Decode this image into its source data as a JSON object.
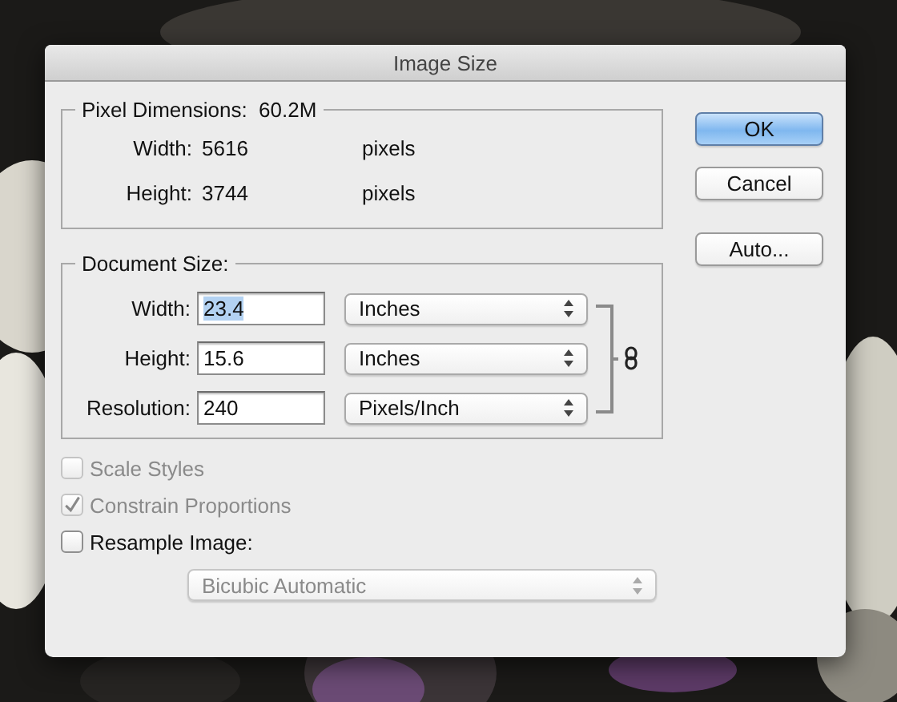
{
  "window": {
    "title": "Image Size"
  },
  "pixel_dimensions": {
    "label": "Pixel Dimensions:",
    "value": "60.2M",
    "rows": [
      {
        "label": "Width:",
        "value": "5616",
        "unit": "pixels"
      },
      {
        "label": "Height:",
        "value": "3744",
        "unit": "pixels"
      }
    ]
  },
  "buttons": [
    {
      "label": "OK",
      "default": true
    },
    {
      "label": "Cancel",
      "default": false
    },
    {
      "label": "Auto...",
      "default": false
    }
  ],
  "document_size": {
    "label": "Document Size:",
    "rows": [
      {
        "label": "Width:",
        "value": "23.4",
        "selected": true,
        "unit": "Inches"
      },
      {
        "label": "Height:",
        "value": "15.6",
        "selected": false,
        "unit": "Inches"
      },
      {
        "label": "Resolution:",
        "value": "240",
        "selected": false,
        "unit": "Pixels/Inch"
      }
    ]
  },
  "options": [
    {
      "label": "Scale Styles",
      "checked": false,
      "disabled": true
    },
    {
      "label": "Constrain Proportions",
      "checked": true,
      "disabled": true
    },
    {
      "label": "Resample Image:",
      "checked": false,
      "disabled": false
    }
  ],
  "resample_method": {
    "value": "Bicubic Automatic",
    "disabled": true
  }
}
